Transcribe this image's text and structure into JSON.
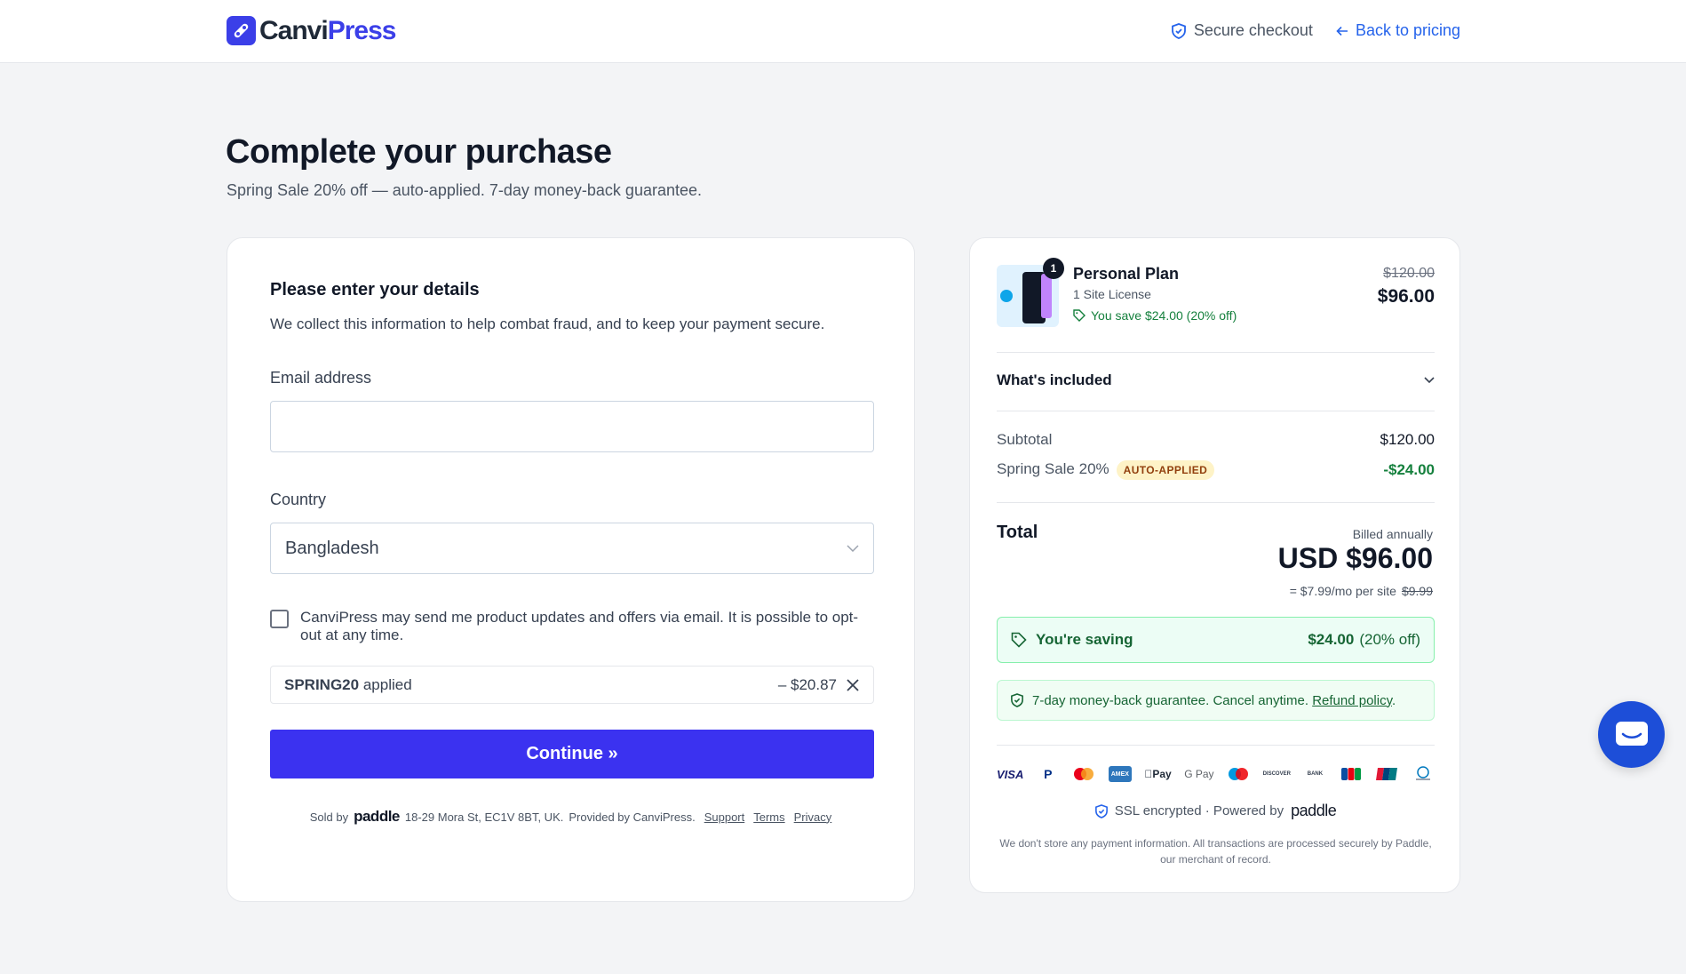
{
  "header": {
    "logo_part1": "Canvi",
    "logo_part2": "Press",
    "secure_label": "Secure checkout",
    "back_label": "Back to pricing"
  },
  "page": {
    "title": "Complete your purchase",
    "subtitle": "Spring Sale 20% off — auto-applied. 7-day money-back guarantee."
  },
  "form": {
    "title": "Please enter your details",
    "description": "We collect this information to help combat fraud, and to keep your payment secure.",
    "email_label": "Email address",
    "email_value": "",
    "country_label": "Country",
    "country_value": "Bangladesh",
    "optin_text": "CanviPress may send me product updates and offers via email. It is possible to opt-out at any time.",
    "optin_checked": false,
    "promo_code": "SPRING20",
    "promo_applied": "applied",
    "promo_amount": "– $20.87",
    "continue_label": "Continue »"
  },
  "footer": {
    "sold_by": "Sold by",
    "paddle": "paddle",
    "address": "18-29 Mora St, EC1V 8BT, UK.",
    "provided_by": "Provided by CanviPress.",
    "support": "Support",
    "terms": "Terms",
    "privacy": "Privacy"
  },
  "summary": {
    "quantity": "1",
    "product_name": "Personal Plan",
    "license": "1 Site License",
    "save_text": "You save $24.00 (20% off)",
    "old_price": "$120.00",
    "new_price": "$96.00",
    "included_label": "What's included",
    "subtotal_label": "Subtotal",
    "subtotal_value": "$120.00",
    "discount_label": "Spring Sale 20%",
    "discount_badge": "AUTO-APPLIED",
    "discount_value": "-$24.00",
    "total_label": "Total",
    "billed": "Billed annually",
    "total_value": "USD $96.00",
    "per_site": "= $7.99/mo per site",
    "per_site_old": "$9.99",
    "saving_label": "You're saving",
    "saving_amount": "$24.00",
    "saving_pct": "(20% off)",
    "guarantee_text": "7-day money-back guarantee. Cancel anytime.",
    "refund_link": "Refund policy",
    "guarantee_end": ".",
    "payment_methods": [
      "VISA",
      "P",
      "MC",
      "AMEX",
      "Pay",
      "G Pay",
      "Maestro",
      "DISCOVER",
      "BANK",
      "JCB",
      "UnionPay",
      "Diners"
    ],
    "ssl_text": "SSL encrypted · Powered by",
    "ssl_paddle": "paddle",
    "disclaimer": "We don't store any payment information. All transactions are processed securely by Paddle, our merchant of record."
  },
  "colors": {
    "brand": "#3b3fe8",
    "button": "#3b32f0",
    "link": "#2563eb",
    "success": "#15803d",
    "chat": "#1d4ed8"
  },
  "icons": [
    "logo-icon",
    "shield-check-icon",
    "arrow-left-icon",
    "chevron-down-icon",
    "tag-icon",
    "close-icon",
    "chat-icon"
  ]
}
